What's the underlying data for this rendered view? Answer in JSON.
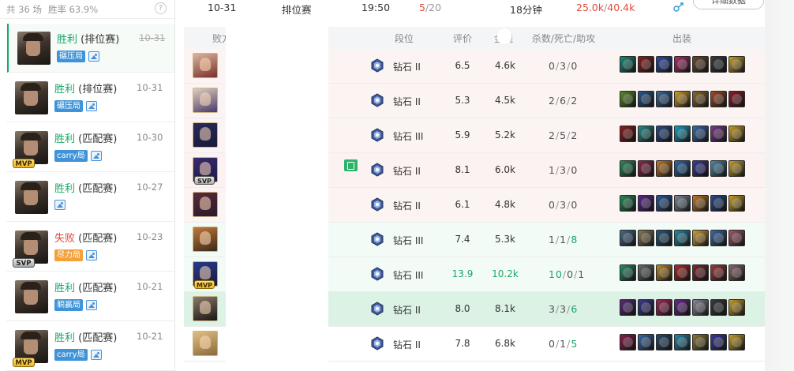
{
  "history": {
    "header": {
      "total": "共 36 场",
      "winrate": "胜率 63.9%",
      "help": "?"
    },
    "matches": [
      {
        "result": "胜利",
        "status": "win",
        "mode": "(排位赛)",
        "date": "10-31",
        "strike": true,
        "tag": "碾压局",
        "tag_color": "blue",
        "badge": ""
      },
      {
        "result": "胜利",
        "status": "win",
        "mode": "(排位赛)",
        "date": "10-31",
        "strike": false,
        "tag": "碾压局",
        "tag_color": "blue",
        "badge": ""
      },
      {
        "result": "胜利",
        "status": "win",
        "mode": "(匹配赛)",
        "date": "10-30",
        "strike": false,
        "tag": "carry局",
        "tag_color": "blue",
        "badge": "MVP"
      },
      {
        "result": "胜利",
        "status": "win",
        "mode": "(匹配赛)",
        "date": "10-27",
        "strike": false,
        "tag": "",
        "tag_color": "",
        "badge": ""
      },
      {
        "result": "失败",
        "status": "lose",
        "mode": "(匹配赛)",
        "date": "10-23",
        "strike": false,
        "tag": "尽力局",
        "tag_color": "orange",
        "badge": "SVP"
      },
      {
        "result": "胜利",
        "status": "win",
        "mode": "(匹配赛)",
        "date": "10-21",
        "strike": false,
        "tag": "躺赢局",
        "tag_color": "blue",
        "badge": ""
      },
      {
        "result": "胜利",
        "status": "win",
        "mode": "(匹配赛)",
        "date": "10-21",
        "strike": false,
        "tag": "carry局",
        "tag_color": "blue",
        "badge": "MVP"
      }
    ]
  },
  "summary": {
    "date": "10-31",
    "mode": "排位赛",
    "time": "19:50",
    "kda_kills": "5",
    "kda_sep": "/",
    "kda_rest": "20",
    "duration": "18分钟",
    "gold_a": "25.0k",
    "gold_sep": "/",
    "gold_b": "40.4k",
    "detail_button": "详细数据"
  },
  "table": {
    "headers": {
      "team": "败方",
      "rank": "段位",
      "score": "评价",
      "gold": "金钱",
      "kda": "杀数/死亡/助攻",
      "items": "出装"
    },
    "rows": [
      {
        "rank": "钻石 II",
        "score": "6.5",
        "gold": "4.6k",
        "k": "0",
        "d": "3",
        "a": "0",
        "badge": "",
        "bg": "lose",
        "champ": [
          "#d9b6a0",
          "#7a2f2a"
        ],
        "items": [
          "#1d8a7a",
          "#8a1f1f",
          "#2d4aa8",
          "#b0306a",
          "#6a4a2a",
          "#3a3a3a",
          "#c8a02a"
        ]
      },
      {
        "rank": "钻石 II",
        "score": "5.3",
        "gold": "4.5k",
        "k": "2",
        "d": "6",
        "a": "2",
        "badge": "",
        "bg": "lose",
        "champ": [
          "#e0d0c0",
          "#4a3a6a"
        ],
        "items": [
          "#5a8a2a",
          "#2a5a8a",
          "#3a6a9a",
          "#d0a02a",
          "#8a6a2a",
          "#a04a2a",
          "#8a1f2a"
        ]
      },
      {
        "rank": "钻石 III",
        "score": "5.9",
        "gold": "5.2k",
        "k": "2",
        "d": "5",
        "a": "2",
        "badge": "",
        "bg": "lose",
        "champ": [
          "#2a2a5a",
          "#1a1a3a"
        ],
        "items": [
          "#8a1f1f",
          "#2a8a8a",
          "#2a4a8a",
          "#1aa0c0",
          "#3a6aa8",
          "#7a3a8a",
          "#c8a02a"
        ]
      },
      {
        "rank": "钻石 II",
        "score": "8.1",
        "gold": "6.0k",
        "k": "1",
        "d": "3",
        "a": "0",
        "badge": "SVP",
        "bg": "even",
        "champ": [
          "#3a2a6a",
          "#1a1a4a"
        ],
        "items": [
          "#2a8a5a",
          "#8a2a4a",
          "#c07a2a",
          "#2a6aa8",
          "#3a3a9a",
          "#4a8aa8",
          "#c8a02a"
        ]
      },
      {
        "rank": "钻石 II",
        "score": "6.1",
        "gold": "4.8k",
        "k": "0",
        "d": "3",
        "a": "0",
        "badge": "",
        "bg": "lose",
        "champ": [
          "#5a2a3a",
          "#2a1a2a"
        ],
        "items": [
          "#2a8a5a",
          "#5a2a8a",
          "#2a5a9a",
          "#7a8a9a",
          "#c07a2a",
          "#2a4a8a",
          "#c8a02a"
        ]
      },
      {
        "rank": "钻石 III",
        "score": "7.4",
        "gold": "5.3k",
        "k": "1",
        "d": "1",
        "a": "8",
        "badge": "",
        "bg": "win",
        "champ": [
          "#c07a3a",
          "#3a2a1a"
        ],
        "items": [
          "#4a6a8a",
          "#8a7a5a",
          "#2a5a7a",
          "#2a8aa8",
          "#d0a03a",
          "#3a6aa8",
          "#a05a6a"
        ]
      },
      {
        "rank": "钻石 III",
        "score": "13.9",
        "gold": "10.2k",
        "k": "10",
        "d": "0",
        "a": "1",
        "badge": "MVP",
        "bg": "win",
        "champ": [
          "#2a3a8a",
          "#1a1a3a"
        ],
        "items": [
          "#2a8a6a",
          "#6a6a6a",
          "#c08a2a",
          "#b02a2a",
          "#7a2a2a",
          "#a03a3a",
          "#8a6a6a"
        ]
      },
      {
        "rank": "钻石 II",
        "score": "8.0",
        "gold": "8.1k",
        "k": "3",
        "d": "3",
        "a": "6",
        "badge": "",
        "bg": "me",
        "champ": [
          "#8a7a6a",
          "#1a1512"
        ],
        "items": [
          "#5a2a7a",
          "#3a3a8a",
          "#a02a5a",
          "#6a2a8a",
          "#8a8a9a",
          "#3a3a3a",
          "#c8a02a"
        ]
      },
      {
        "rank": "钻石 II",
        "score": "7.8",
        "gold": "6.8k",
        "k": "0",
        "d": "1",
        "a": "5",
        "badge": "",
        "bg": "white",
        "champ": [
          "#e0c080",
          "#8a6a3a"
        ],
        "items": [
          "#8a1f4a",
          "#3a6aa8",
          "#2a4a6a",
          "#2a8aa8",
          "#8a7a3a",
          "#3a3a9a",
          "#c8a02a"
        ]
      }
    ]
  },
  "colors": {
    "win": "#1aa868",
    "lose": "#e04a3a",
    "accent_blue": "#3e93d9"
  }
}
